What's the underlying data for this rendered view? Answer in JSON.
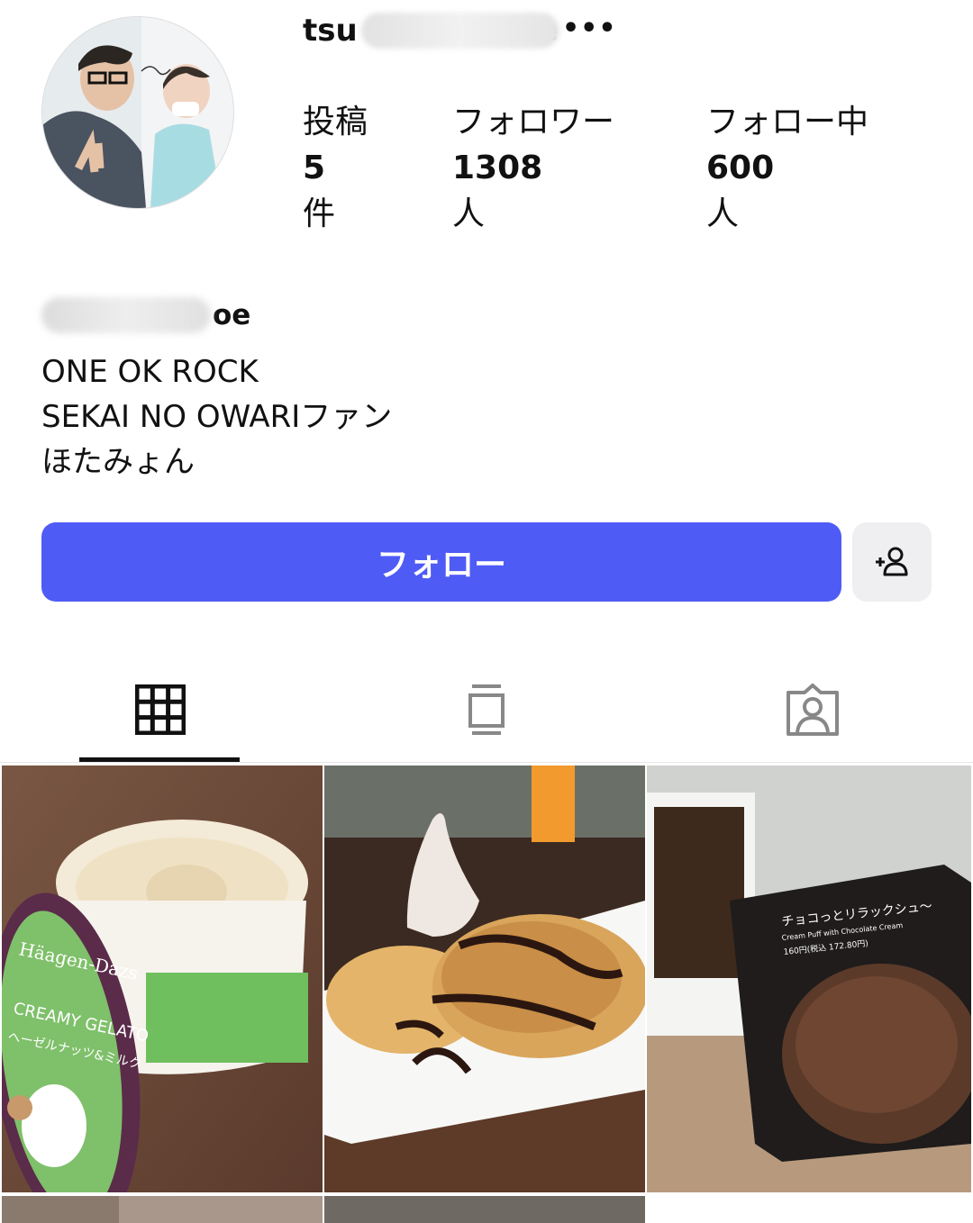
{
  "profile": {
    "username_visible": "tsu",
    "username_tail": "e",
    "more_icon": "more-icon",
    "stats": {
      "posts": {
        "label": "投稿",
        "value": "5",
        "unit": "件"
      },
      "followers": {
        "label": "フォロワー",
        "value": "1308",
        "unit": "人"
      },
      "following": {
        "label": "フォロー中",
        "value": "600",
        "unit": "人"
      }
    },
    "display_name_tail": "oe",
    "bio": [
      "ONE OK ROCK",
      "SEKAI NO OWARIファン",
      "ほたみょん"
    ]
  },
  "actions": {
    "follow_label": "フォロー",
    "suggest_icon": "add-person-icon",
    "follow_color": "#4f5bf5"
  },
  "tabs": [
    {
      "icon": "grid-icon",
      "active": true
    },
    {
      "icon": "reels-icon",
      "active": false
    },
    {
      "icon": "tagged-icon",
      "active": false
    }
  ],
  "posts": [
    {
      "labels": [
        "Häagen-Dazs",
        "CREAMY GELATO",
        "ヘーゼルナッツ&ミルク"
      ]
    },
    {
      "labels": []
    },
    {
      "labels": [
        "チョコっとリラックシュ〜",
        "Cream Puff with Chocolate Cream",
        "160円(税込 172.80円)"
      ]
    }
  ]
}
